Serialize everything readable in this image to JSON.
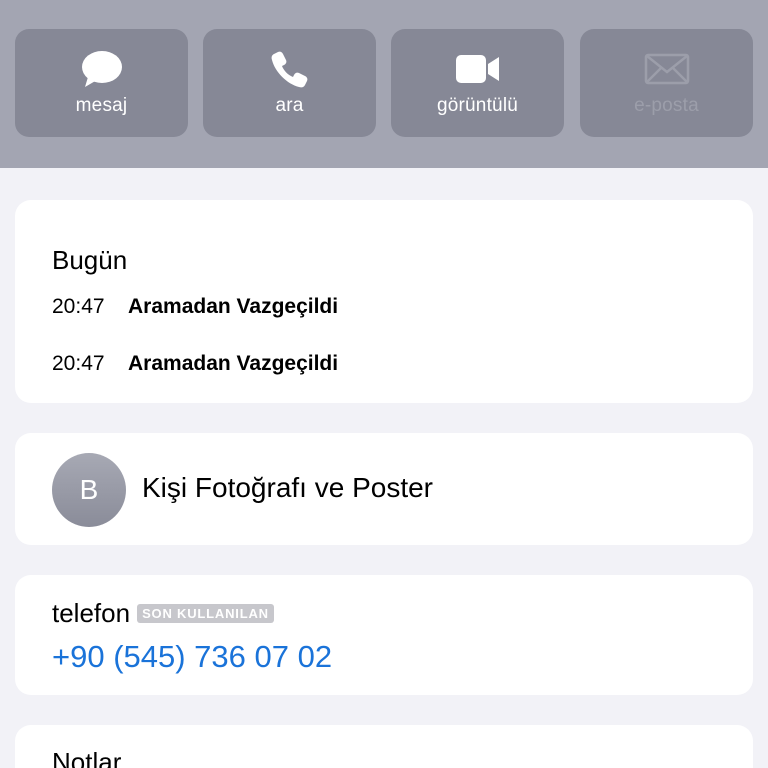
{
  "actions": [
    {
      "label": "mesaj",
      "icon": "message-icon",
      "enabled": true
    },
    {
      "label": "ara",
      "icon": "phone-icon",
      "enabled": true
    },
    {
      "label": "görüntülü",
      "icon": "video-icon",
      "enabled": true
    },
    {
      "label": "e-posta",
      "icon": "mail-icon",
      "enabled": false
    }
  ],
  "history": {
    "title": "Bugün",
    "entries": [
      {
        "time": "20:47",
        "status": "Aramadan Vazgeçildi"
      },
      {
        "time": "20:47",
        "status": "Aramadan Vazgeçildi"
      }
    ]
  },
  "photo": {
    "avatar_letter": "B",
    "label": "Kişi Fotoğrafı ve Poster"
  },
  "phone": {
    "label": "telefon",
    "badge": "SON KULLANILAN",
    "number": "+90 (545) 736 07 02"
  },
  "notes": {
    "label": "Notlar"
  },
  "colors": {
    "header_bg": "#a3a5b2",
    "button_bg": "#868896",
    "link": "#1a73d9",
    "background": "#f2f2f7"
  }
}
